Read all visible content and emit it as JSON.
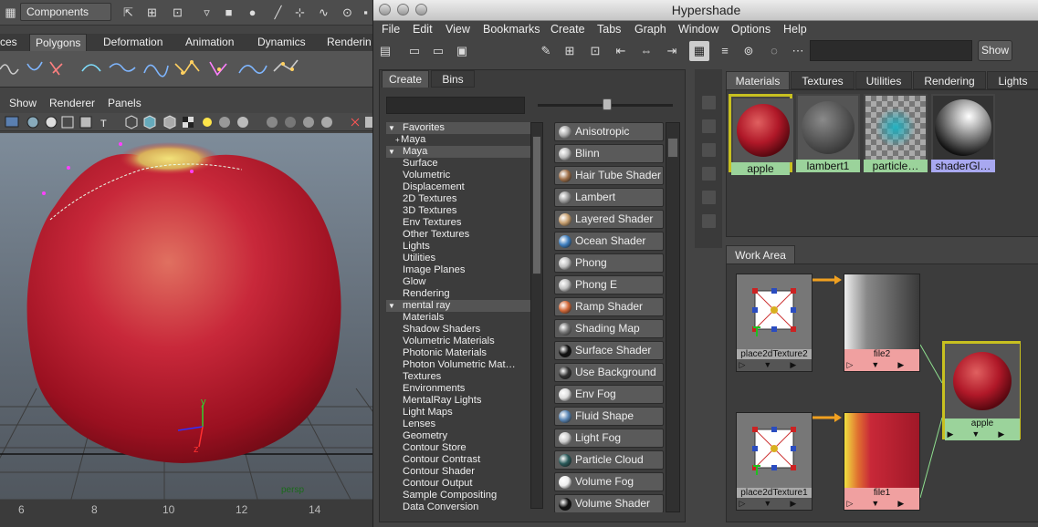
{
  "maya": {
    "components_label": "Components",
    "shelf_tabs": [
      "ces",
      "Polygons",
      "Deformation",
      "Animation",
      "Dynamics",
      "Renderin"
    ],
    "viewport_menu": [
      "Show",
      "Renderer",
      "Panels"
    ],
    "camera_label": "persp",
    "axis_y": "y",
    "axis_z": "z",
    "ruler_ticks": [
      "6",
      "8",
      "10",
      "12",
      "14"
    ]
  },
  "hypershade": {
    "title": "Hypershade",
    "menu": [
      "File",
      "Edit",
      "View",
      "Bookmarks",
      "Create",
      "Tabs",
      "Graph",
      "Window",
      "Options",
      "Help"
    ],
    "show_button": "Show",
    "search_value": "",
    "left_tabs": [
      "Create",
      "Bins"
    ],
    "tree": [
      {
        "label": "Favorites",
        "type": "header",
        "prefix": "▼"
      },
      {
        "label": "Maya",
        "type": "sub",
        "prefix": "+"
      },
      {
        "label": "Maya",
        "type": "header",
        "prefix": "▼"
      },
      {
        "label": "Surface",
        "type": "item"
      },
      {
        "label": "Volumetric",
        "type": "item"
      },
      {
        "label": "Displacement",
        "type": "item"
      },
      {
        "label": "2D Textures",
        "type": "item"
      },
      {
        "label": "3D Textures",
        "type": "item"
      },
      {
        "label": "Env Textures",
        "type": "item"
      },
      {
        "label": "Other Textures",
        "type": "item"
      },
      {
        "label": "Lights",
        "type": "item"
      },
      {
        "label": "Utilities",
        "type": "item"
      },
      {
        "label": "Image Planes",
        "type": "item"
      },
      {
        "label": "Glow",
        "type": "item"
      },
      {
        "label": "Rendering",
        "type": "item"
      },
      {
        "label": "mental ray",
        "type": "header",
        "prefix": "▼"
      },
      {
        "label": "Materials",
        "type": "item"
      },
      {
        "label": "Shadow Shaders",
        "type": "item"
      },
      {
        "label": "Volumetric Materials",
        "type": "item"
      },
      {
        "label": "Photonic Materials",
        "type": "item"
      },
      {
        "label": "Photon Volumetric Mat…",
        "type": "item"
      },
      {
        "label": "Textures",
        "type": "item"
      },
      {
        "label": "Environments",
        "type": "item"
      },
      {
        "label": "MentalRay Lights",
        "type": "item"
      },
      {
        "label": "Light Maps",
        "type": "item"
      },
      {
        "label": "Lenses",
        "type": "item"
      },
      {
        "label": "Geometry",
        "type": "item"
      },
      {
        "label": "Contour Store",
        "type": "item"
      },
      {
        "label": "Contour Contrast",
        "type": "item"
      },
      {
        "label": "Contour Shader",
        "type": "item"
      },
      {
        "label": "Contour Output",
        "type": "item"
      },
      {
        "label": "Sample Compositing",
        "type": "item"
      },
      {
        "label": "Data Conversion",
        "type": "item"
      }
    ],
    "shaders": [
      {
        "label": "Anisotropic",
        "ball": "#aaaaaa"
      },
      {
        "label": "Blinn",
        "ball": "#bbbbbb"
      },
      {
        "label": "Hair Tube Shader",
        "ball": "#a0714a"
      },
      {
        "label": "Lambert",
        "ball": "#9a9a9a"
      },
      {
        "label": "Layered Shader",
        "ball": "#c8a070"
      },
      {
        "label": "Ocean Shader",
        "ball": "#3f7fbf"
      },
      {
        "label": "Phong",
        "ball": "#c0c0c0"
      },
      {
        "label": "Phong E",
        "ball": "#c0c0c0"
      },
      {
        "label": "Ramp Shader",
        "ball": "#d46a3a"
      },
      {
        "label": "Shading Map",
        "ball": "#777777"
      },
      {
        "label": "Surface Shader",
        "ball": "#111111"
      },
      {
        "label": "Use Background",
        "ball": "#333333"
      },
      {
        "label": "Env Fog",
        "ball": "#dddddd"
      },
      {
        "label": "Fluid Shape",
        "ball": "#5a86b5"
      },
      {
        "label": "Light Fog",
        "ball": "#cccccc"
      },
      {
        "label": "Particle Cloud",
        "ball": "#2a5a5a"
      },
      {
        "label": "Volume Fog",
        "ball": "#eeeeee"
      },
      {
        "label": "Volume Shader",
        "ball": "#111111"
      }
    ],
    "top_tabs": [
      "Materials",
      "Textures",
      "Utilities",
      "Rendering",
      "Lights"
    ],
    "materials": [
      {
        "label": "apple",
        "selected": true
      },
      {
        "label": "lambert1",
        "selected": false
      },
      {
        "label": "particle…",
        "selected": false
      },
      {
        "label": "shaderGl…",
        "selected": false
      }
    ],
    "work_area_tab": "Work Area",
    "nodes": {
      "place2d_a": "place2dTexture2",
      "file_a": "file2",
      "place2d_b": "place2dTexture1",
      "file_b": "file1",
      "apple": "apple"
    }
  },
  "colors": {
    "selected_border": "#c8c020",
    "material_label_bg": "#9bd39b",
    "file_label_bg": "#f0a0a0",
    "connection_arrow": "#f0a020",
    "connection_line": "#8fe08f"
  }
}
